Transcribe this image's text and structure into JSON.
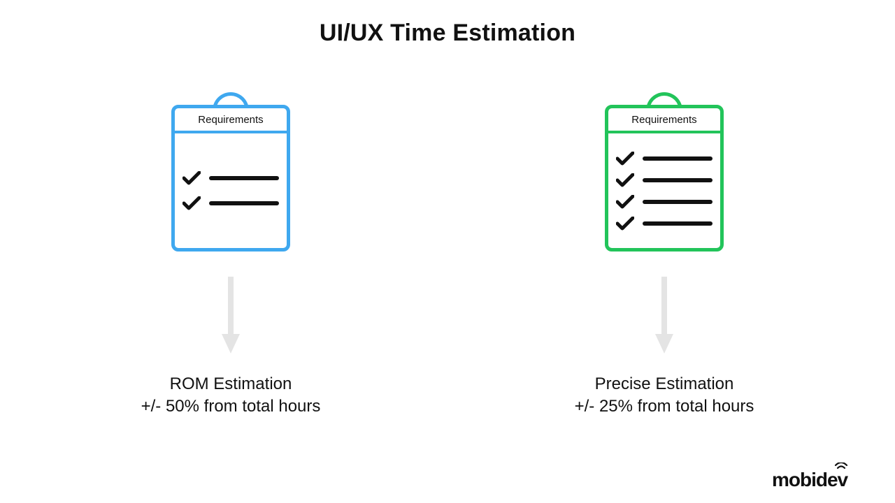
{
  "title": "UI/UX Time Estimation",
  "columns": [
    {
      "header": "Requirements",
      "caption_line1": "ROM Estimation",
      "caption_line2": "+/- 50% from total hours",
      "color": "blue",
      "check_count": 2
    },
    {
      "header": "Requirements",
      "caption_line1": "Precise Estimation",
      "caption_line2": "+/- 25% from total hours",
      "color": "green",
      "check_count": 4
    }
  ],
  "logo_text": "mobidev",
  "colors": {
    "blue": "#3fa8ef",
    "green": "#22c45a",
    "arrow": "#e4e4e4",
    "ink": "#111111"
  }
}
